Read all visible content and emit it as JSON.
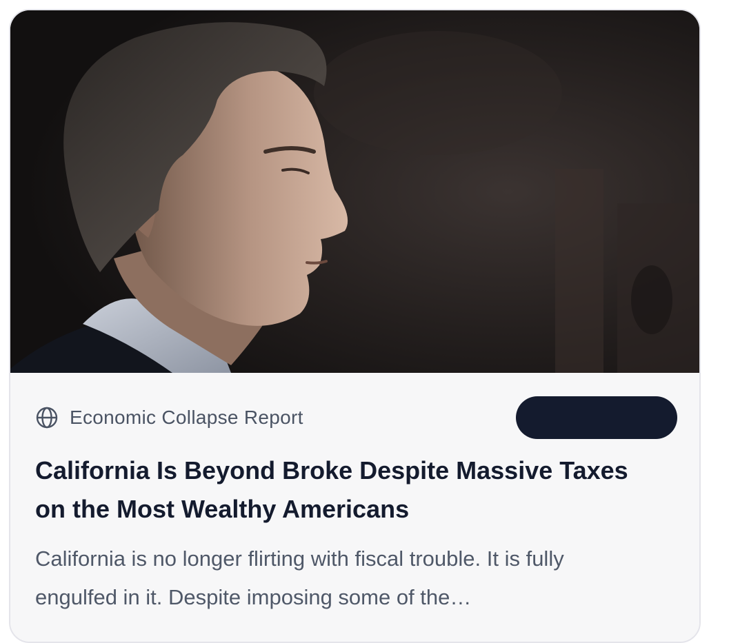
{
  "card": {
    "image_alt": "Portrait of a man in profile against a dark background",
    "source": {
      "icon": "globe-icon",
      "name": "Economic Collapse Report"
    },
    "action_button": {
      "label": ""
    },
    "headline": "California Is Beyond Broke Despite Massive Taxes on the Most Wealthy Americans",
    "summary": "California is no longer flirting with fiscal trouble. It is fully engulfed in it. Despite imposing some of the…"
  },
  "colors": {
    "card_background": "#f7f7f8",
    "headline": "#141b2e",
    "source_text": "#4a5363",
    "summary_text": "#4f5868",
    "button": "#141b2e",
    "border": "#e4e4ea"
  }
}
